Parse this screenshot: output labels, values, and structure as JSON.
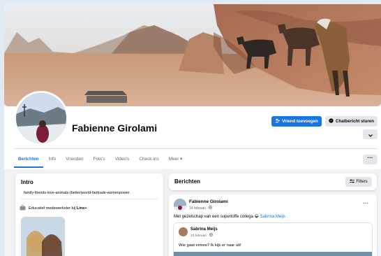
{
  "profile": {
    "name": "Fabienne Girolami",
    "buttons": {
      "add_friend": "Vriend toevoegen",
      "message": "Chatbericht sturen"
    },
    "icons": {
      "add_friend": "add-person-icon",
      "message": "messenger-icon",
      "chevron": "chevron-down-icon",
      "more": "more-dots-icon"
    }
  },
  "tabs": [
    {
      "label": "Berichten",
      "active": true
    },
    {
      "label": "Info"
    },
    {
      "label": "Vrienden"
    },
    {
      "label": "Foto's"
    },
    {
      "label": "Video's"
    },
    {
      "label": "Check-ins"
    },
    {
      "label": "Meer ▾"
    }
  ],
  "intro": {
    "title": "Intro",
    "bio": "family-friends-love-animals-(better)world-fairtrade-womenpower",
    "work_prefix": "Educatief medewerkster bij ",
    "work_place": "Linx+"
  },
  "posts_header": {
    "title": "Berichten",
    "filters_label": "Filters"
  },
  "post": {
    "author": "Fabienne Girolami",
    "date": "14 februari · ",
    "text": "Met gezelschap van een supertoffe collega ",
    "emoji": "😀",
    "mention": "Sabrina Meijs",
    "more": "···",
    "shared": {
      "author": "Sabrina Meijs",
      "date": "13 februari · ",
      "text": "Wie gaat ermee? Ik kijk er naar uit!"
    }
  },
  "colors": {
    "accent": "#1b74e4",
    "background": "#f0f2f5",
    "secondary_button": "#e4e6eb"
  }
}
